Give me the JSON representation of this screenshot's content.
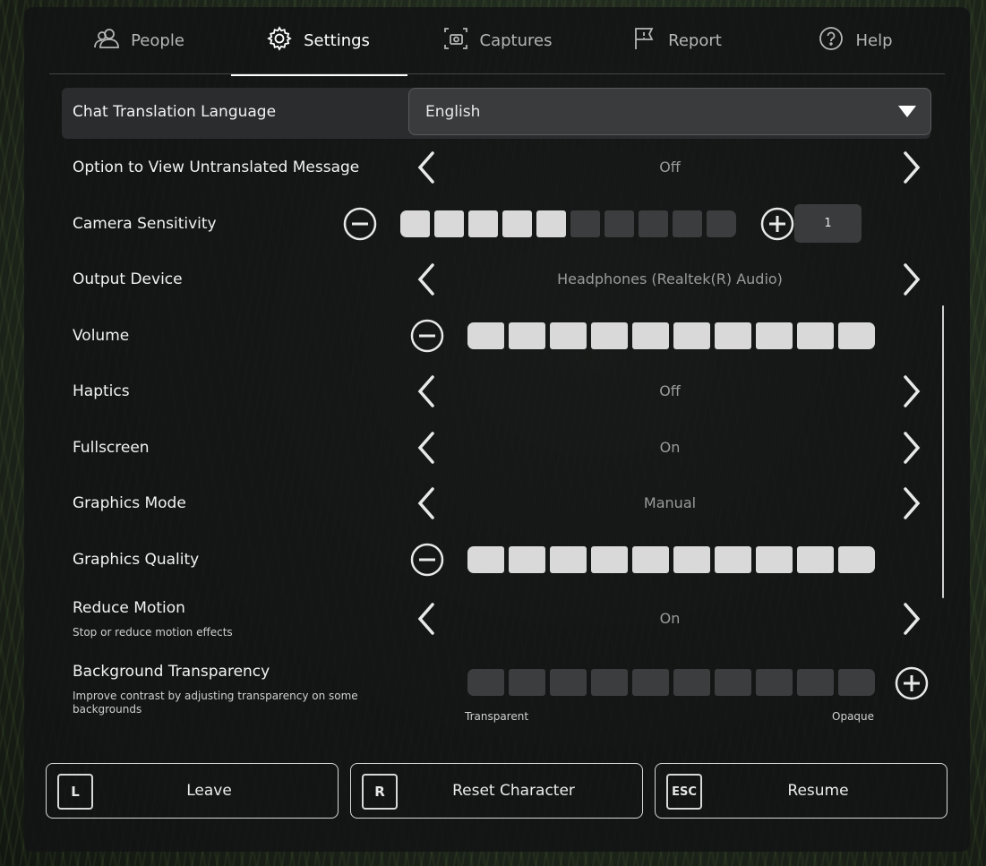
{
  "tabs": [
    {
      "label": "People",
      "icon": "people-icon"
    },
    {
      "label": "Settings",
      "icon": "gear-icon"
    },
    {
      "label": "Captures",
      "icon": "camera-icon"
    },
    {
      "label": "Report",
      "icon": "flag-icon"
    },
    {
      "label": "Help",
      "icon": "help-icon"
    }
  ],
  "active_tab": "Settings",
  "settings": {
    "chat_translation": {
      "label": "Chat Translation Language",
      "value": "English"
    },
    "untranslated": {
      "label": "Option to View Untranslated Message",
      "value": "Off"
    },
    "camera_sensitivity": {
      "label": "Camera Sensitivity",
      "level_filled": 5,
      "segments": 10,
      "value": "1"
    },
    "output_device": {
      "label": "Output Device",
      "value": "Headphones (Realtek(R) Audio)"
    },
    "volume": {
      "label": "Volume",
      "level_filled": 10,
      "segments": 10
    },
    "haptics": {
      "label": "Haptics",
      "value": "Off"
    },
    "fullscreen": {
      "label": "Fullscreen",
      "value": "On"
    },
    "graphics_mode": {
      "label": "Graphics Mode",
      "value": "Manual"
    },
    "graphics_quality": {
      "label": "Graphics Quality",
      "level_filled": 10,
      "segments": 10
    },
    "reduce_motion": {
      "label": "Reduce Motion",
      "description": "Stop or reduce motion effects",
      "value": "On"
    },
    "background_transparency": {
      "label": "Background Transparency",
      "description": "Improve contrast by adjusting transparency on some backgrounds",
      "level_filled": 0,
      "segments": 10,
      "min_label": "Transparent",
      "max_label": "Opaque"
    }
  },
  "buttons": {
    "leave": {
      "key": "L",
      "label": "Leave"
    },
    "reset": {
      "key": "R",
      "label": "Reset Character"
    },
    "resume": {
      "key": "ESC",
      "label": "Resume"
    }
  },
  "colors": {
    "segment_on": "#d9d9d9",
    "segment_off": "#3c3d3f",
    "panel": "#121314"
  }
}
